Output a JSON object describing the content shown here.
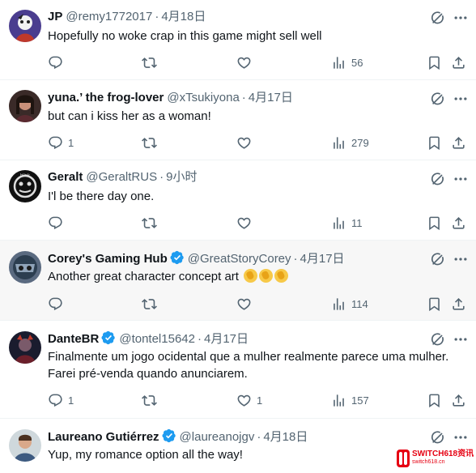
{
  "colors": {
    "text": "#0f1419",
    "secondary": "#536471",
    "verified": "#1d9bf0",
    "border": "#eff3f4",
    "watermark": "#e60012"
  },
  "tweets": [
    {
      "name": "JP",
      "handle": "@remy1772017",
      "sep": "·",
      "time": "4月18日",
      "verified": false,
      "text": "Hopefully no woke crap in this game might sell well",
      "replies": "",
      "retweets": "",
      "likes": "",
      "views": "56"
    },
    {
      "name": "yuna.’ the frog-lover",
      "handle": "@xTsukiyona",
      "sep": "·",
      "time": "4月17日",
      "verified": false,
      "text": "but can i kiss her as a woman!",
      "replies": "1",
      "retweets": "",
      "likes": "",
      "views": "279"
    },
    {
      "name": "Geralt",
      "handle": "@GeraltRUS",
      "sep": "·",
      "time": "9小时",
      "verified": false,
      "text": "I'l be there day one.",
      "replies": "",
      "retweets": "",
      "likes": "",
      "views": "11"
    },
    {
      "name": "Corey's Gaming Hub",
      "handle": "@GreatStoryCorey",
      "sep": "·",
      "time": "4月17日",
      "verified": true,
      "text": "Another great character concept art",
      "emoji": "clapping-hands x3",
      "replies": "",
      "retweets": "",
      "likes": "",
      "views": "114"
    },
    {
      "name": "DanteBR",
      "handle": "@tontel15642",
      "sep": "·",
      "time": "4月17日",
      "verified": true,
      "text": "Finalmente um jogo ocidental que a mulher realmente parece uma mulher.",
      "text2": "Farei pré-venda quando anunciarem.",
      "replies": "1",
      "retweets": "",
      "likes": "1",
      "views": "157"
    },
    {
      "name": "Laureano Gutiérrez",
      "handle": "@laureanojgv",
      "sep": "·",
      "time": "4月18日",
      "verified": true,
      "text": "Yup, my romance option all the way!"
    }
  ],
  "icons": [
    "reply-icon",
    "retweet-icon",
    "like-icon",
    "views-icon",
    "bookmark-icon",
    "share-icon",
    "grok-icon",
    "more-icon",
    "verified-badge-icon"
  ],
  "watermark": {
    "main": "SWITCH618资讯",
    "sub": "switch618.cn"
  }
}
